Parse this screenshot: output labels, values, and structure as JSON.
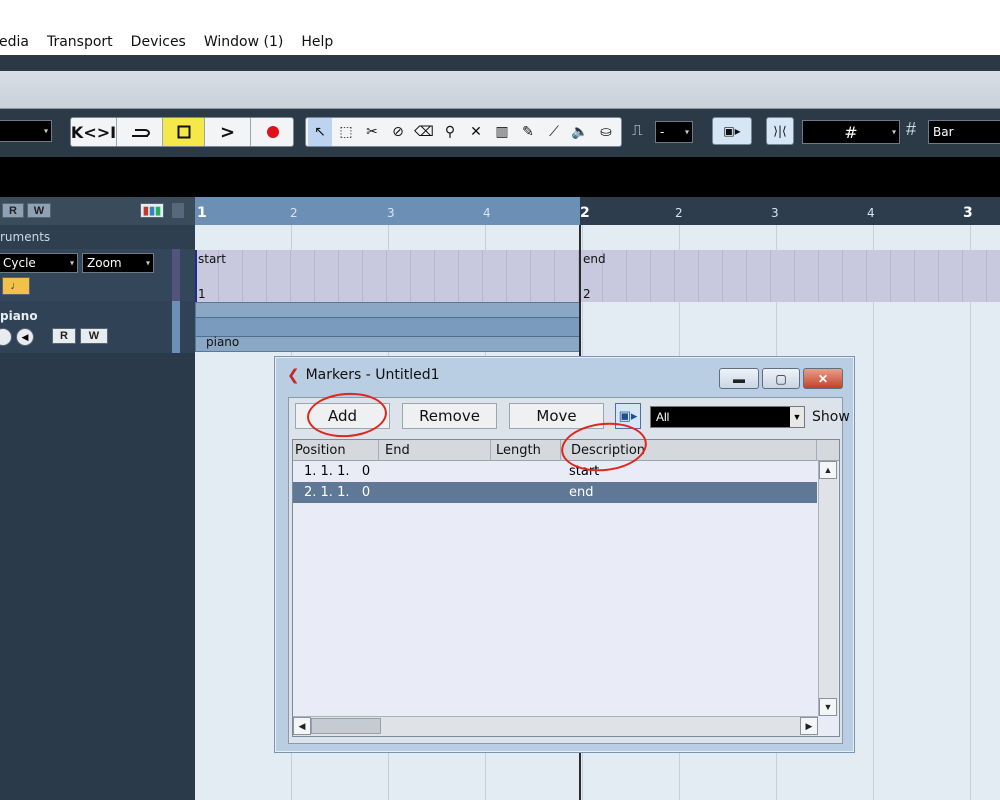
{
  "menubar": {
    "items": [
      "edia",
      "Transport",
      "Devices",
      "Window (1)",
      "Help"
    ]
  },
  "toolbar": {
    "transport": {
      "prev_icon": "K<>I",
      "cycle_icon": "loop-icon",
      "stop_icon": "stop-icon",
      "play_icon": ">",
      "record_icon": "record-icon"
    },
    "tools": [
      "select-icon",
      "range-icon",
      "split-icon",
      "glue-icon",
      "erase-icon",
      "zoom-icon",
      "mute-icon",
      "timewarp-icon",
      "draw-icon",
      "line-icon",
      "play-tool-icon",
      "color-icon"
    ],
    "nudge_value": "-",
    "grid_label": "#",
    "snap_mode": "Bar"
  },
  "tracklist": {
    "header_buttons": [
      "R",
      "W"
    ],
    "instruments_label": "ruments",
    "cycle_label": "Cycle",
    "zoom_label": "Zoom",
    "piano_track": "piano",
    "rw_buttons": [
      "R",
      "W"
    ]
  },
  "ruler": {
    "labels": [
      "1",
      "2",
      "3",
      "4",
      "2",
      "2",
      "3",
      "4",
      "3"
    ]
  },
  "lane": {
    "markers": [
      {
        "name": "start",
        "id": "1"
      },
      {
        "name": "end",
        "id": "2"
      }
    ],
    "event_label": "piano"
  },
  "dialog": {
    "title": "Markers - Untitled1",
    "buttons": {
      "add": "Add",
      "remove": "Remove",
      "move": "Move"
    },
    "filter_value": "All",
    "show_label": "Show",
    "columns": [
      "Position",
      "End",
      "Length",
      "Description"
    ],
    "rows": [
      {
        "position": "1. 1. 1.   0",
        "end": "",
        "length": "",
        "description": "start",
        "selected": false
      },
      {
        "position": "2. 1. 1.   0",
        "end": "",
        "length": "",
        "description": "end",
        "selected": true
      }
    ]
  },
  "colors": {
    "accent": "#5e7895",
    "annotation": "#e0261c",
    "record": "#e0101c",
    "stop_highlight": "#f5e94a"
  }
}
